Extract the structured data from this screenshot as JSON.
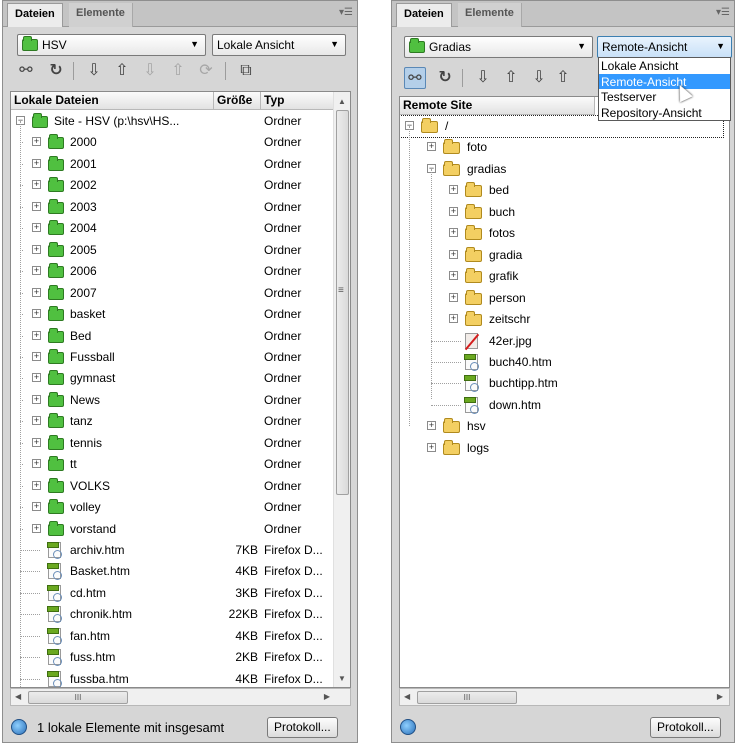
{
  "left_panel": {
    "tabs": [
      {
        "label": "Dateien"
      },
      {
        "label": "Elemente"
      }
    ],
    "site_select": "HSV",
    "view_select": "Lokale Ansicht",
    "columns": {
      "name": "Lokale Dateien",
      "size": "Größe",
      "type": "Typ"
    },
    "rows": [
      {
        "name": "Site - HSV (p:\\hsv\\HS...",
        "size": "",
        "type": "Ordner"
      },
      {
        "name": "2000",
        "size": "",
        "type": "Ordner"
      },
      {
        "name": "2001",
        "size": "",
        "type": "Ordner"
      },
      {
        "name": "2002",
        "size": "",
        "type": "Ordner"
      },
      {
        "name": "2003",
        "size": "",
        "type": "Ordner"
      },
      {
        "name": "2004",
        "size": "",
        "type": "Ordner"
      },
      {
        "name": "2005",
        "size": "",
        "type": "Ordner"
      },
      {
        "name": "2006",
        "size": "",
        "type": "Ordner"
      },
      {
        "name": "2007",
        "size": "",
        "type": "Ordner"
      },
      {
        "name": "basket",
        "size": "",
        "type": "Ordner"
      },
      {
        "name": "Bed",
        "size": "",
        "type": "Ordner"
      },
      {
        "name": "Fussball",
        "size": "",
        "type": "Ordner"
      },
      {
        "name": "gymnast",
        "size": "",
        "type": "Ordner"
      },
      {
        "name": "News",
        "size": "",
        "type": "Ordner"
      },
      {
        "name": "tanz",
        "size": "",
        "type": "Ordner"
      },
      {
        "name": "tennis",
        "size": "",
        "type": "Ordner"
      },
      {
        "name": "tt",
        "size": "",
        "type": "Ordner"
      },
      {
        "name": "VOLKS",
        "size": "",
        "type": "Ordner"
      },
      {
        "name": "volley",
        "size": "",
        "type": "Ordner"
      },
      {
        "name": "vorstand",
        "size": "",
        "type": "Ordner"
      },
      {
        "name": "archiv.htm",
        "size": "7KB",
        "type": "Firefox D..."
      },
      {
        "name": "Basket.htm",
        "size": "4KB",
        "type": "Firefox D..."
      },
      {
        "name": "cd.htm",
        "size": "3KB",
        "type": "Firefox D..."
      },
      {
        "name": "chronik.htm",
        "size": "22KB",
        "type": "Firefox D..."
      },
      {
        "name": "fan.htm",
        "size": "4KB",
        "type": "Firefox D..."
      },
      {
        "name": "fuss.htm",
        "size": "2KB",
        "type": "Firefox D..."
      },
      {
        "name": "fussba.htm",
        "size": "4KB",
        "type": "Firefox D..."
      }
    ],
    "status_text": "1 lokale Elemente mit insgesamt",
    "protokoll_label": "Protokoll..."
  },
  "right_panel": {
    "tabs": [
      {
        "label": "Dateien"
      },
      {
        "label": "Elemente"
      }
    ],
    "site_select": "Gradias",
    "view_select": "Remote-Ansicht",
    "dropdown_options": [
      "Lokale Ansicht",
      "Remote-Ansicht",
      "Testserver",
      "Repository-Ansicht"
    ],
    "selected_option": "Remote-Ansicht",
    "column": "Remote Site",
    "tree": [
      {
        "name": "/"
      },
      {
        "name": "foto"
      },
      {
        "name": "gradias"
      },
      {
        "name": "bed"
      },
      {
        "name": "buch"
      },
      {
        "name": "fotos"
      },
      {
        "name": "gradia"
      },
      {
        "name": "grafik"
      },
      {
        "name": "person"
      },
      {
        "name": "zeitschr"
      },
      {
        "name": "42er.jpg"
      },
      {
        "name": "buch40.htm"
      },
      {
        "name": "buchtipp.htm"
      },
      {
        "name": "down.htm"
      },
      {
        "name": "hsv"
      },
      {
        "name": "logs"
      }
    ],
    "protokoll_label": "Protokoll..."
  },
  "hscroll_grip": "III",
  "colors": {
    "panel_bg": "#d6d6d6",
    "selection": "#3399ff",
    "folder_local": "#50c040",
    "folder_remote": "#f3cf62"
  }
}
